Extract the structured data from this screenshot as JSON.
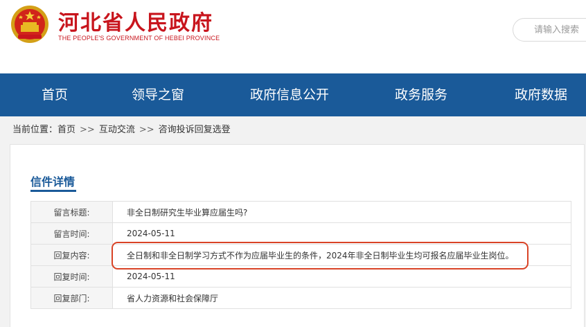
{
  "header": {
    "title": "河北省人民政府",
    "subtitle": "THE PEOPLE'S GOVERNMENT OF HEBEI PROVINCE",
    "emblem_icon": "national-emblem-icon"
  },
  "search": {
    "placeholder": "请输入搜索"
  },
  "nav": {
    "items": [
      {
        "label": "首页"
      },
      {
        "label": "领导之窗"
      },
      {
        "label": "政府信息公开"
      },
      {
        "label": "政务服务"
      },
      {
        "label": "政府数据"
      }
    ]
  },
  "breadcrumb": {
    "prefix": "当前位置：",
    "separator": ">>",
    "items": [
      "首页",
      "互动交流",
      "咨询投诉回复选登"
    ]
  },
  "detail": {
    "heading": "信件详情",
    "rows": [
      {
        "label": "留言标题:",
        "value": "非全日制研究生毕业算应届生吗?"
      },
      {
        "label": "留言时间:",
        "value": "2024-05-11"
      },
      {
        "label": "回复内容:",
        "value": "全日制和非全日制学习方式不作为应届毕业生的条件，2024年非全日制毕业生均可报名应届毕业生岗位。"
      },
      {
        "label": "回复时间:",
        "value": "2024-05-11"
      },
      {
        "label": "回复部门:",
        "value": "省人力资源和社会保障厅"
      }
    ]
  },
  "colors": {
    "brand_red": "#c8151d",
    "nav_blue": "#1a5a99",
    "highlight_red": "#d94326"
  }
}
